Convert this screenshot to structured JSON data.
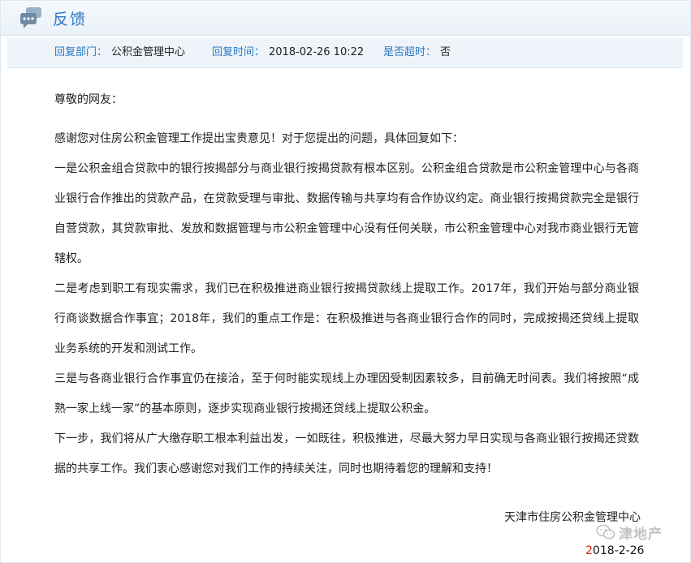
{
  "header": {
    "icon": "chat-bubbles-icon",
    "title": "反馈"
  },
  "meta": {
    "dept_label": "回复部门：",
    "dept_value": "公积金管理中心",
    "time_label": "回复时间：",
    "time_value": "2018-02-26 10:22",
    "overdue_label": "是否超时：",
    "overdue_value": "否"
  },
  "content": {
    "greeting": "尊敬的网友：",
    "paragraphs": [
      "感谢您对住房公积金管理工作提出宝贵意见！对于您提出的问题，具体回复如下：",
      "一是公积金组合贷款中的银行按揭部分与商业银行按揭贷款有根本区别。公积金组合贷款是市公积金管理中心与各商业银行合作推出的贷款产品，在贷款受理与审批、数据传输与共享均有合作协议约定。商业银行按揭贷款完全是银行自营贷款，其贷款审批、发放和数据管理与市公积金管理中心没有任何关联，市公积金管理中心对我市商业银行无管辖权。",
      "二是考虑到职工有现实需求，我们已在积极推进商业银行按揭贷款线上提取工作。2017年，我们开始与部分商业银行商谈数据合作事宜；2018年，我们的重点工作是：在积极推进与各商业银行合作的同时，完成按揭还贷线上提取业务系统的开发和测试工作。",
      "三是与各商业银行合作事宜仍在接洽，至于何时能实现线上办理因受制因素较多，目前确无时间表。我们将按照“成熟一家上线一家”的基本原则，逐步实现商业银行按揭还贷线上提取公积金。",
      "下一步，我们将从广大缴存职工根本利益出发，一如既往，积极推进，尽最大努力早日实现与各商业银行按揭还贷数据的共享工作。我们衷心感谢您对我们工作的持续关注，同时也期待着您的理解和支持！"
    ]
  },
  "signature": {
    "org": "天津市住房公积金管理中心",
    "date_first": "2",
    "date_rest": "018-2-26"
  },
  "watermark": {
    "icon": "wechat-icon",
    "text": "津地产"
  },
  "colors": {
    "accent": "#2b78c2",
    "date_red": "#d81e06"
  }
}
